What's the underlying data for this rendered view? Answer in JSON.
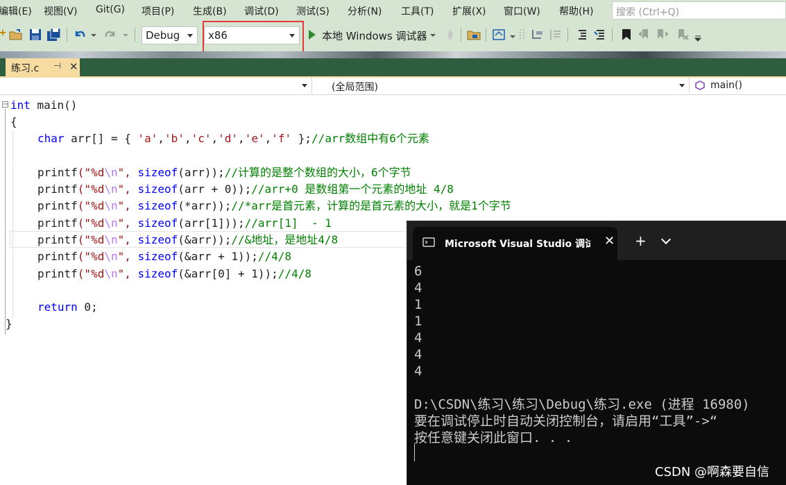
{
  "menu": {
    "items": [
      "编辑(E)",
      "视图(V)",
      "Git(G)",
      "项目(P)",
      "生成(B)",
      "调试(D)",
      "测试(S)",
      "分析(N)",
      "工具(T)",
      "扩展(X)",
      "窗口(W)",
      "帮助(H)"
    ],
    "search_placeholder": "搜索 (Ctrl+Q)"
  },
  "toolbar": {
    "configuration": "Debug",
    "platform": "x86",
    "debugger_label": "本地 Windows 调试器",
    "icons": [
      "new-file-icon",
      "open-folder-icon",
      "save-icon",
      "save-all-icon",
      "undo-icon",
      "redo-icon",
      "start-icon",
      "hot-reload-icon",
      "solution-explorer-icon",
      "properties-icon",
      "bookmark-icon"
    ]
  },
  "tab": {
    "filename": "练习.c",
    "pin_glyph": "⊣",
    "close_glyph": "✕"
  },
  "navbar": {
    "scope": "(全局范围)",
    "member": "main()"
  },
  "code": {
    "l1_kw": "int",
    "l1_rest": " main()",
    "l2": "{",
    "l3_kw": "char",
    "l3_a": " arr[] = { ",
    "l3_s1": "'a'",
    "l3_s2": "'b'",
    "l3_s3": "'c'",
    "l3_s4": "'d'",
    "l3_s5": "'e'",
    "l3_s6": "'f'",
    "l3_end": " };",
    "l3_cmt": "//arr数组中有6个元素",
    "printf": "printf",
    "fmt_open": "(\"%d",
    "fmt_esc": "\\n",
    "fmt_close": "\", ",
    "sizeof": "sizeof",
    "p1_arg": "(arr));",
    "p1_cmt": "//计算的是整个数组的大小，6个字节",
    "p2_arg": "(arr + 0));",
    "p2_cmt": "//arr+0 是数组第一个元素的地址 4/8",
    "p3_arg": "(*arr));",
    "p3_cmt": "//*arr是首元素，计算的是首元素的大小，就是1个字节",
    "p4_arg": "(arr[1]));",
    "p4_cmt": "//arr[1]  - 1",
    "p5_arg": "(&arr));",
    "p5_cmt": "//&地址，是地址4/8",
    "p6_arg": "(&arr + 1));",
    "p6_cmt": "//4/8",
    "p7_arg": "(&arr[0] + 1));",
    "p7_cmt": "//4/8",
    "ret_kw": "return",
    "ret_rest": " 0;",
    "close": "}"
  },
  "terminal": {
    "title": "Microsoft Visual Studio 调试控制台",
    "output": [
      "6",
      "4",
      "1",
      "1",
      "4",
      "4",
      "4"
    ],
    "exit_line": "D:\\CSDN\\练习\\练习\\Debug\\练习.exe (进程 16980)",
    "hint_line": "要在调试停止时自动关闭控制台，请启用“工具”->“",
    "close_line": "按任意键关闭此窗口. . ."
  },
  "watermark": "CSDN @啊森要自信",
  "colors": {
    "chrome": "#d6e4d2",
    "tab_strip": "#2f5d3f",
    "active_tab": "#f6dca0",
    "keyword": "#0000ff",
    "string": "#a31515",
    "comment": "#008000",
    "highlight_box": "#e03a3a",
    "terminal_bg": "#0c0c0c"
  }
}
